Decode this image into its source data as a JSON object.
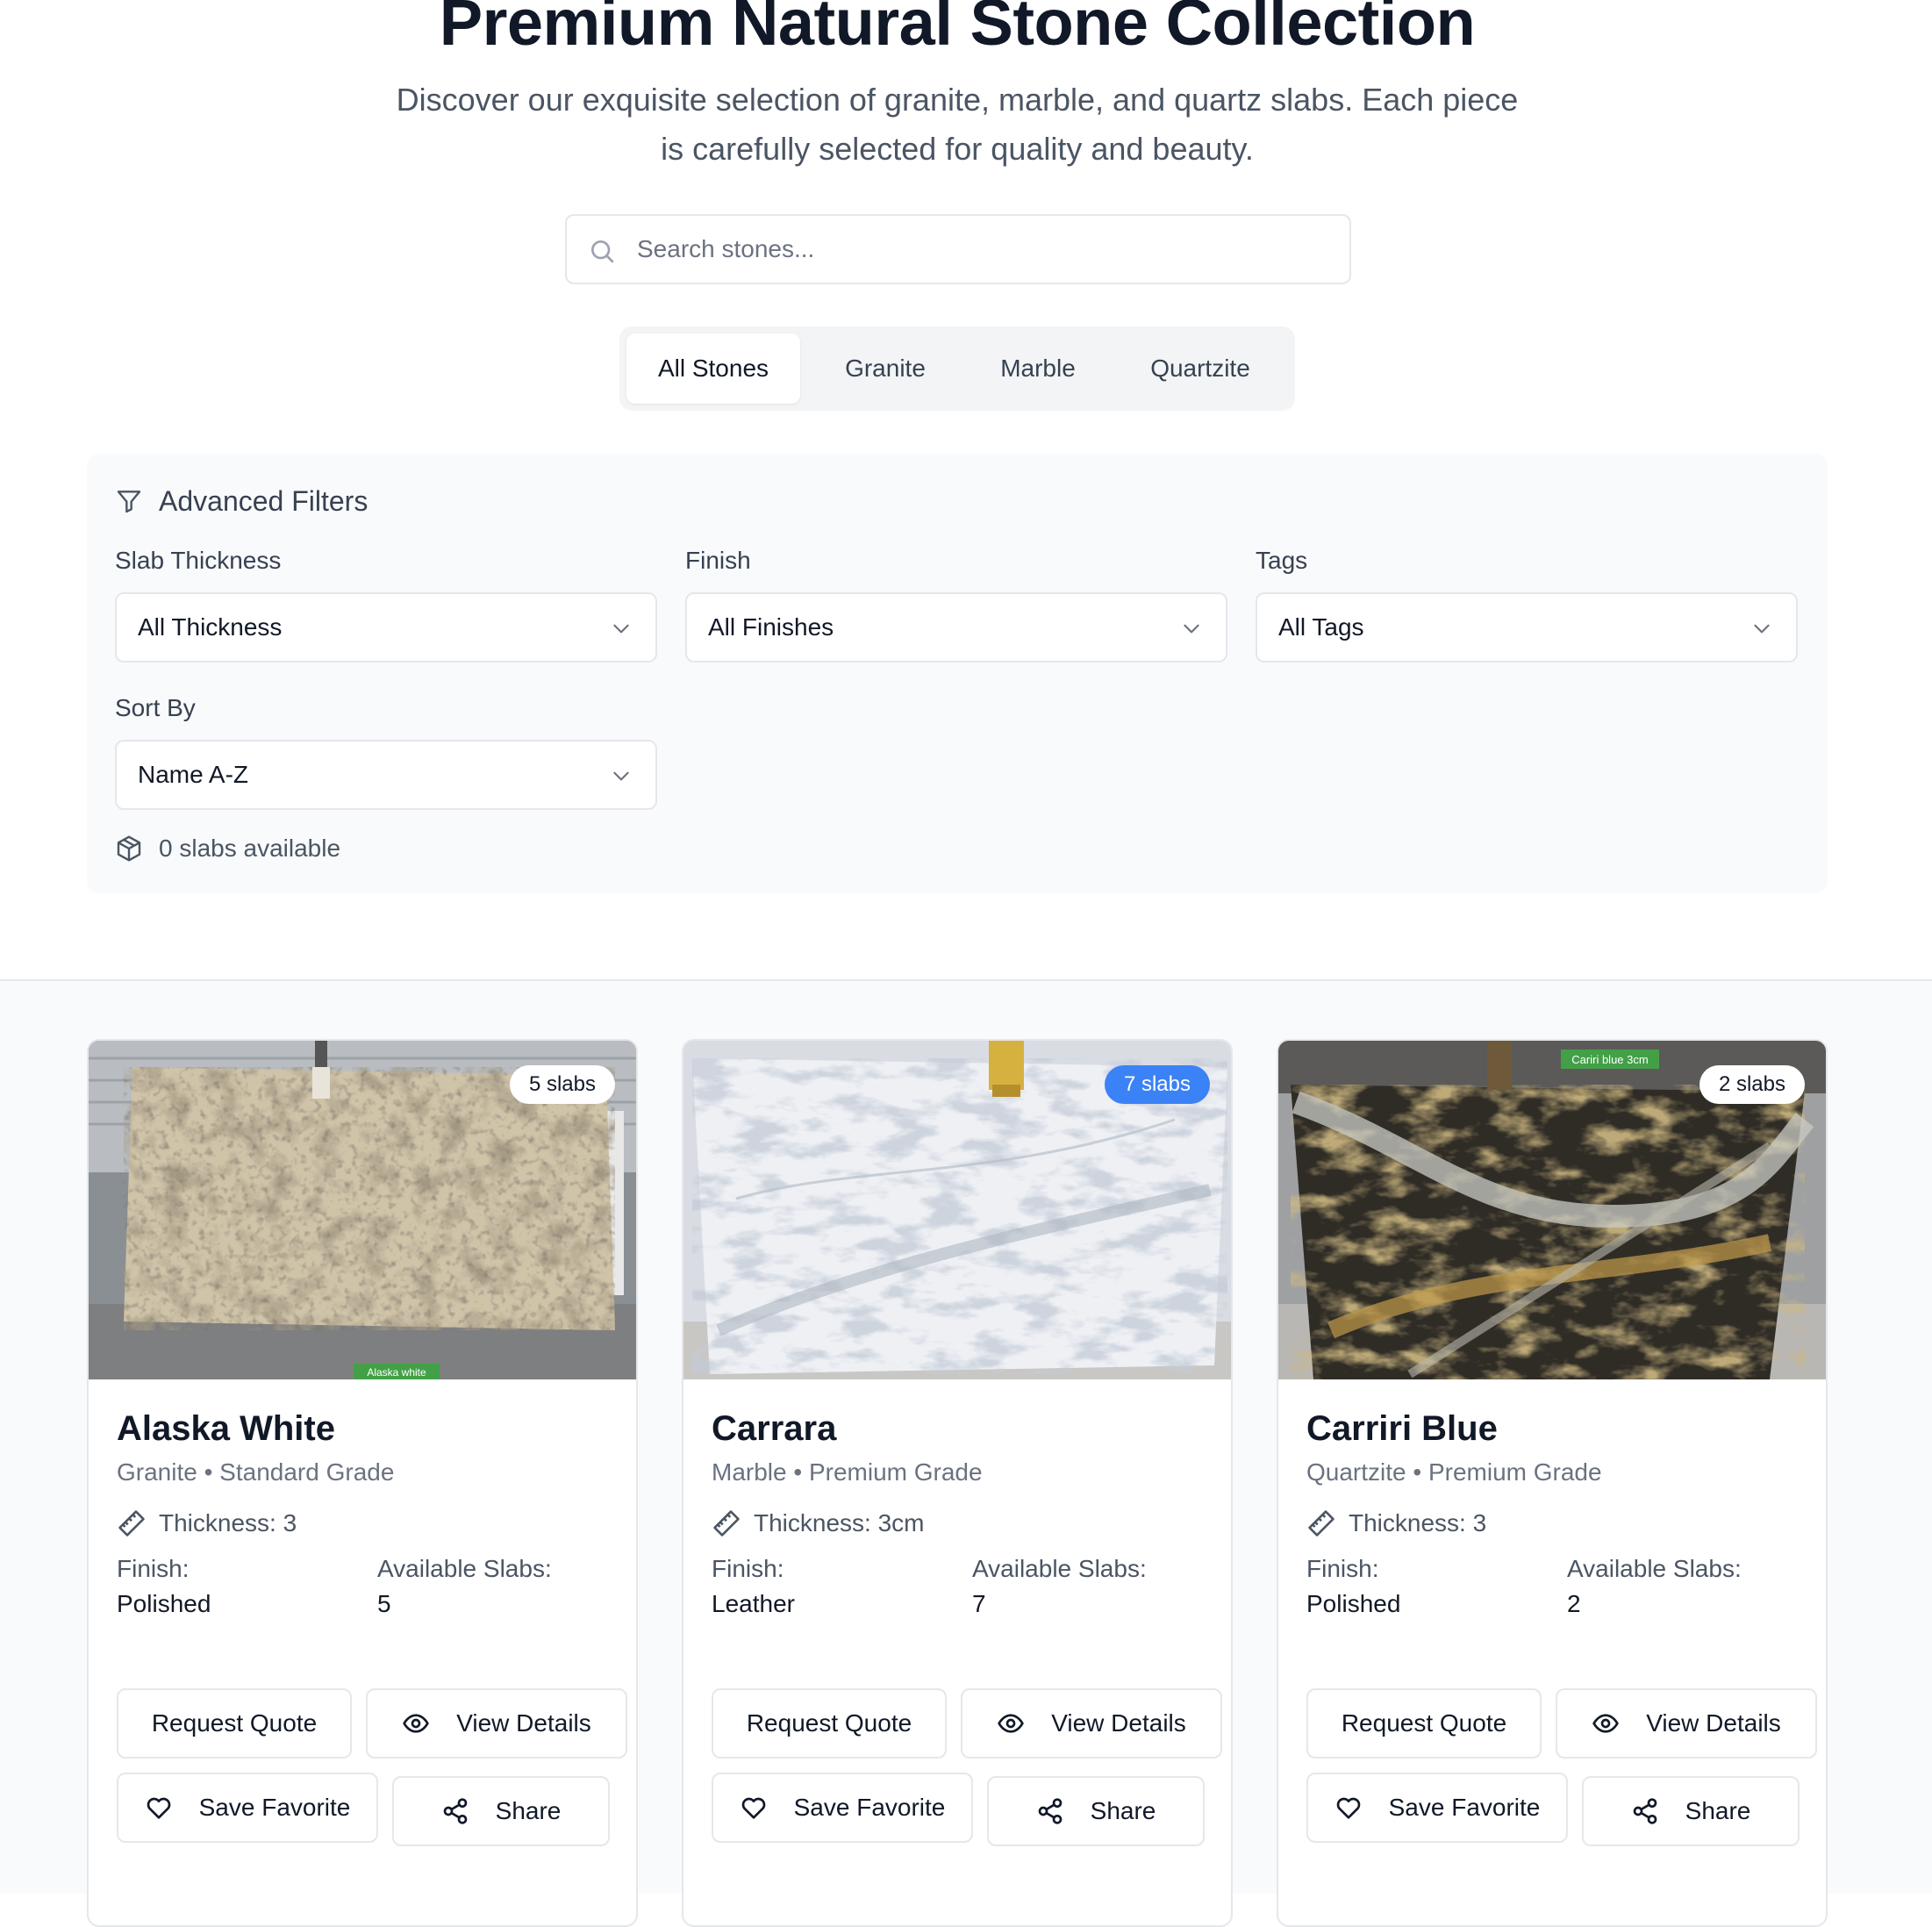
{
  "header": {
    "title": "Premium Natural Stone Collection",
    "subtitle": "Discover our exquisite selection of granite, marble, and quartz slabs. Each piece is carefully selected for quality and beauty."
  },
  "search": {
    "placeholder": "Search stones..."
  },
  "tabs": [
    {
      "label": "All Stones",
      "active": true
    },
    {
      "label": "Granite",
      "active": false
    },
    {
      "label": "Marble",
      "active": false
    },
    {
      "label": "Quartzite",
      "active": false
    }
  ],
  "filters": {
    "title": "Advanced Filters",
    "thickness": {
      "label": "Slab Thickness",
      "value": "All Thickness"
    },
    "finish": {
      "label": "Finish",
      "value": "All Finishes"
    },
    "tags": {
      "label": "Tags",
      "value": "All Tags"
    },
    "sort": {
      "label": "Sort By",
      "value": "Name A-Z"
    },
    "count": "0 slabs available"
  },
  "products": [
    {
      "badge": "5 slabs",
      "name": "Alaska White",
      "meta": "Granite • Standard Grade",
      "thickness": "Thickness: 3",
      "finish_label": "Finish:",
      "finish": "Polished",
      "slabs_label": "Available Slabs:",
      "slabs": "5",
      "image_tag": "Alaska white",
      "actions": {
        "quote": "Request Quote",
        "details": "View Details",
        "favorite": "Save Favorite",
        "share": "Share"
      }
    },
    {
      "badge": "7 slabs",
      "name": "Carrara",
      "meta": "Marble • Premium Grade",
      "thickness": "Thickness: 3cm",
      "finish_label": "Finish:",
      "finish": "Leather",
      "slabs_label": "Available Slabs:",
      "slabs": "7",
      "actions": {
        "quote": "Request Quote",
        "details": "View Details",
        "favorite": "Save Favorite",
        "share": "Share"
      }
    },
    {
      "badge": "2 slabs",
      "name": "Carriri Blue",
      "meta": "Quartzite • Premium Grade",
      "thickness": "Thickness: 3",
      "finish_label": "Finish:",
      "finish": "Polished",
      "slabs_label": "Available Slabs:",
      "slabs": "2",
      "image_tag": "Cariri blue 3cm",
      "actions": {
        "quote": "Request Quote",
        "details": "View Details",
        "favorite": "Save Favorite",
        "share": "Share"
      }
    }
  ],
  "colors": {
    "accent_blue": "#3b82f6",
    "text_dark": "#111827",
    "text_muted": "#6b7280",
    "border": "#e5e7eb",
    "panel_bg": "#f9fafb",
    "tag_green": "#4caf50"
  }
}
